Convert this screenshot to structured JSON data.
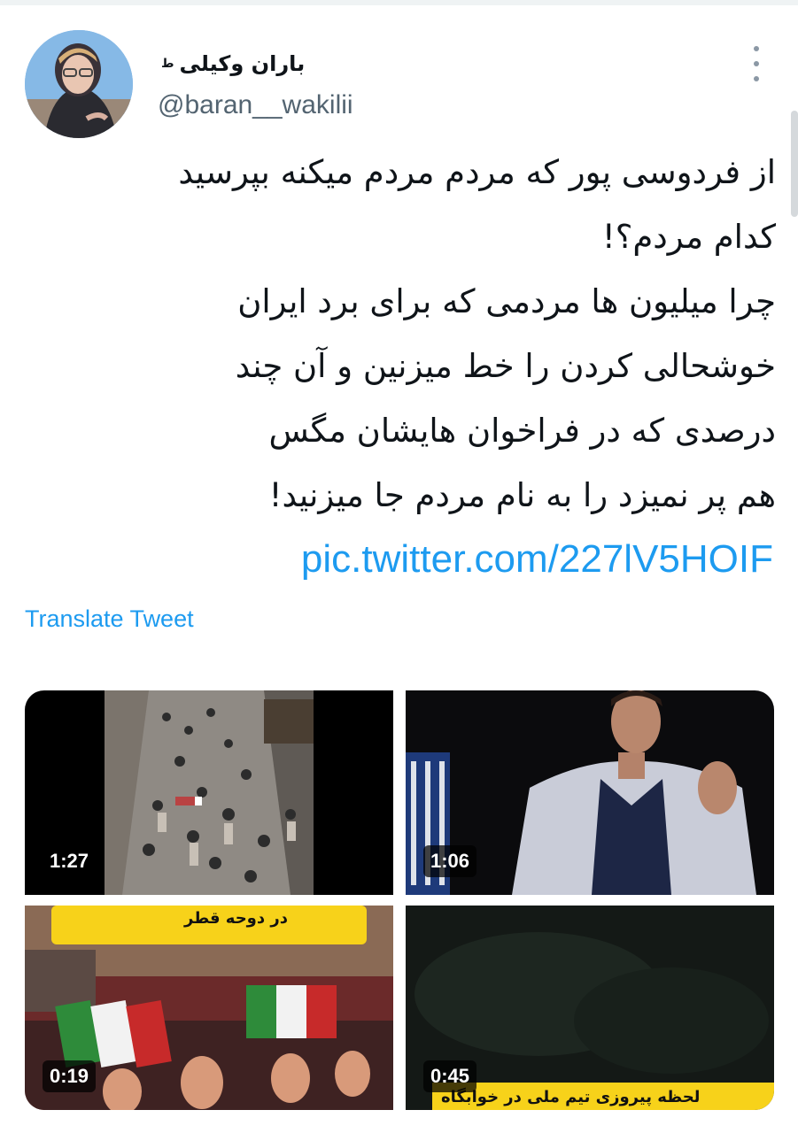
{
  "profile": {
    "display_name": "باران وکیلی",
    "verified_mark": "ط",
    "handle": "@baran__wakilii"
  },
  "tweet": {
    "lines": [
      "از فردوسی پور که مردم مردم میکنه بپرسید",
      "کدام مردم؟!",
      "چرا میلیون ها مردمی که برای برد ایران",
      "خوشحالی کردن را خط میزنین و آن چند",
      "درصدی که در فراخوان هایشان مگس",
      "هم پر نمیزد را به نام مردم جا میزنید!"
    ],
    "link": "pic.twitter.com/227lV5HOIF",
    "translate_label": "Translate Tweet"
  },
  "media": [
    {
      "duration": "1:27",
      "icon": "video-crowd-street"
    },
    {
      "duration": "1:06",
      "icon": "video-man-interview"
    },
    {
      "duration": "0:19",
      "icon": "video-celebration-flags",
      "caption": "در دوحه قطر"
    },
    {
      "duration": "0:45",
      "icon": "video-dark-night",
      "caption": "لحظه پیروزی تیم ملی در خوابگاه"
    }
  ],
  "colors": {
    "link": "#1d9bf0",
    "handle": "#536471",
    "duration_bg": "#000000"
  }
}
